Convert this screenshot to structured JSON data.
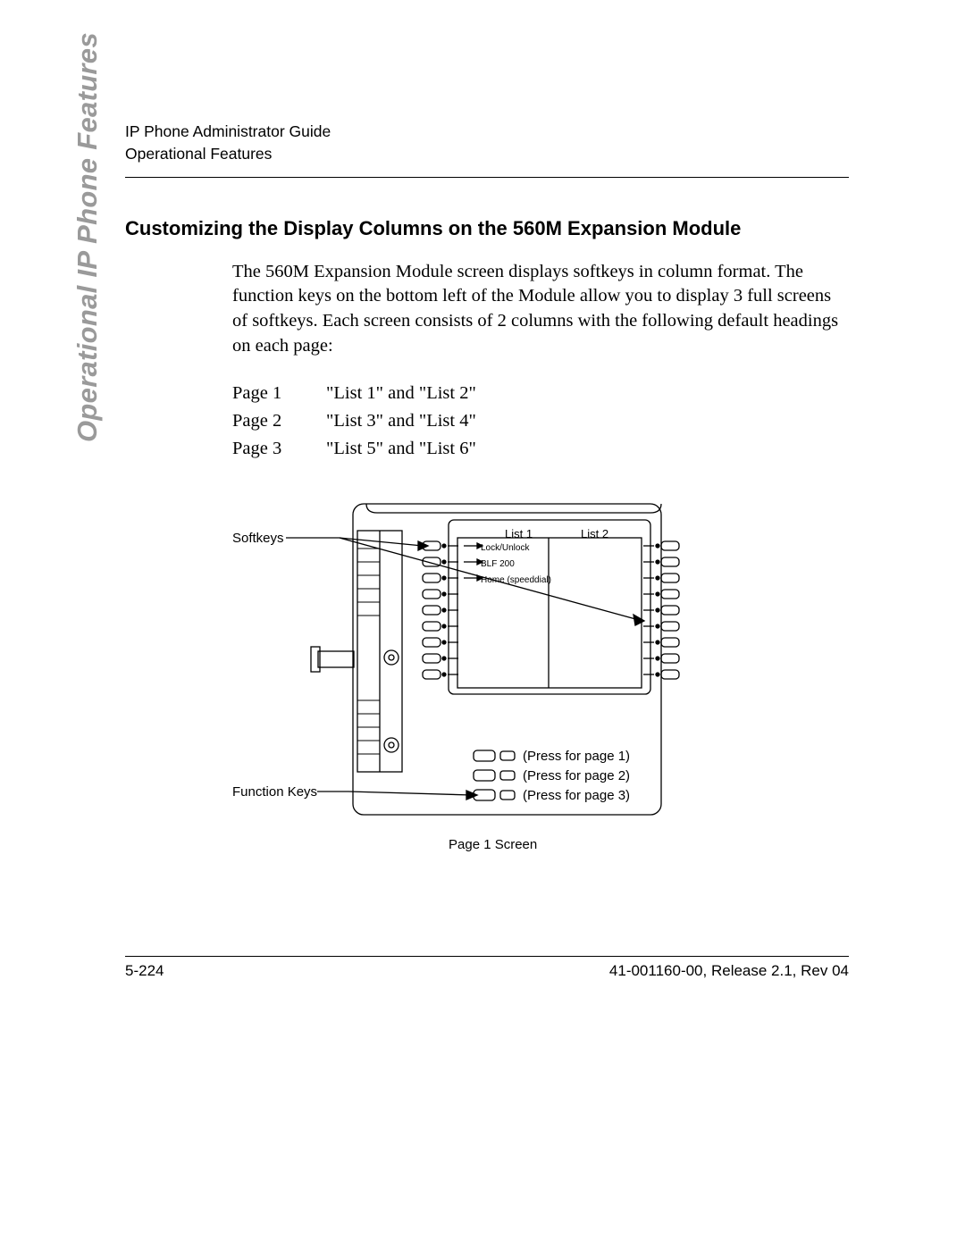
{
  "header": {
    "line1": "IP Phone Administrator Guide",
    "line2": "Operational Features"
  },
  "side_tab": "Operational IP Phone Features",
  "section_title": "Customizing the Display Columns on the 560M Expansion Module",
  "paragraph": "The 560M Expansion Module screen displays softkeys in column format. The function keys on the bottom left of the Module allow you to display 3 full screens of softkeys. Each screen consists of 2 columns with the following default headings on each page:",
  "page_table": [
    {
      "page": "Page 1",
      "cols": "\"List 1\" and \"List 2\""
    },
    {
      "page": "Page 2",
      "cols": "\"List 3\" and \"List 4\""
    },
    {
      "page": "Page 3",
      "cols": "\"List 5\" and \"List 6\""
    }
  ],
  "figure": {
    "callouts": {
      "softkeys": "Softkeys",
      "function_keys": "Function Keys"
    },
    "column_headers": {
      "list1": "List 1",
      "list2": "List 2"
    },
    "screen_rows": [
      "Lock/Unlock",
      "BLF 200",
      "Home (speeddial)"
    ],
    "press_labels": [
      "(Press for page 1)",
      "(Press for page 2)",
      "(Press for page 3)"
    ],
    "caption": "Page 1 Screen"
  },
  "footer": {
    "left": "5-224",
    "right": "41-001160-00, Release 2.1, Rev 04"
  }
}
